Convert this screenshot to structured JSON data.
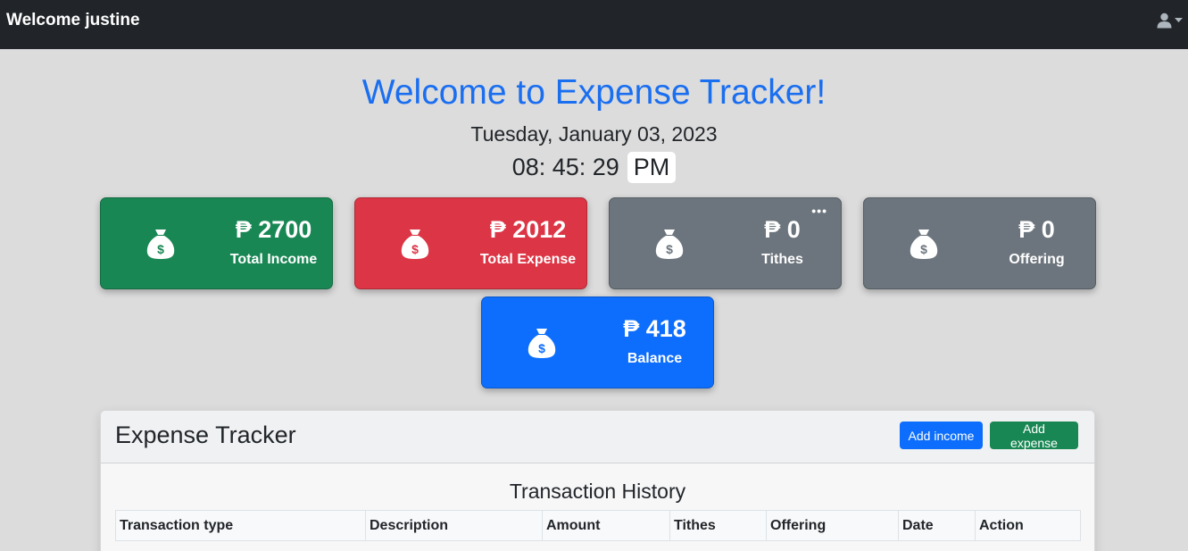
{
  "navbar": {
    "brand": "Welcome justine",
    "user_icon": "user-icon",
    "dropdown_icon": "caret-down-icon"
  },
  "hero": {
    "title": "Welcome to Expense Tracker!",
    "date": "Tuesday, January 03, 2023",
    "time": "08: 45: 29",
    "ampm": "PM"
  },
  "cards": {
    "income": {
      "amount": "₱ 2700",
      "label": "Total Income",
      "icon": "money-bag-icon",
      "color": "#198754"
    },
    "expense": {
      "amount": "₱ 2012",
      "label": "Total Expense",
      "icon": "money-bag-icon",
      "color": "#dc3545"
    },
    "tithes": {
      "amount": "₱ 0",
      "label": "Tithes",
      "icon": "money-bag-icon",
      "color": "#6c757d",
      "menu": "•••"
    },
    "offering": {
      "amount": "₱ 0",
      "label": "Offering",
      "icon": "money-bag-icon",
      "color": "#6c757d"
    },
    "balance": {
      "amount": "₱ 418",
      "label": "Balance",
      "icon": "money-bag-icon",
      "color": "#0d6efd"
    }
  },
  "panel": {
    "title": "Expense Tracker",
    "add_income_label": "Add income",
    "add_expense_label": "Add expense",
    "history_title": "Transaction History",
    "columns": [
      "Transaction type",
      "Description",
      "Amount",
      "Tithes",
      "Offering",
      "Date",
      "Action"
    ]
  }
}
